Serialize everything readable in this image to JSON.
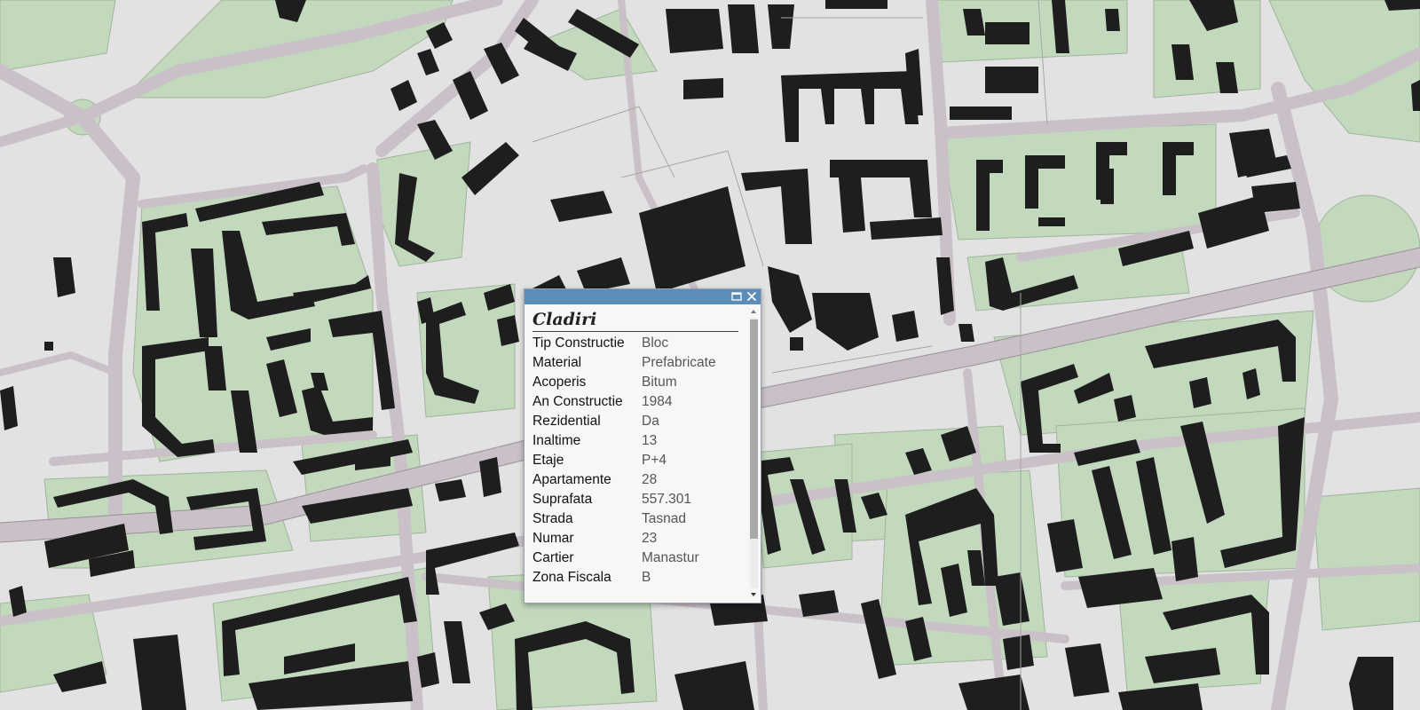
{
  "popup": {
    "title": "Cladiri",
    "maximize_icon": "maximize-icon",
    "close_icon": "close-icon",
    "fields": [
      {
        "key": "Tip Constructie",
        "value": "Bloc"
      },
      {
        "key": "Material",
        "value": "Prefabricate"
      },
      {
        "key": "Acoperis",
        "value": "Bitum"
      },
      {
        "key": "An Constructie",
        "value": "1984"
      },
      {
        "key": "Rezidential",
        "value": "Da"
      },
      {
        "key": "Inaltime",
        "value": "13"
      },
      {
        "key": "Etaje",
        "value": "P+4"
      },
      {
        "key": "Apartamente",
        "value": "28"
      },
      {
        "key": "Suprafata",
        "value": "557.301"
      },
      {
        "key": "Strada",
        "value": "Tasnad"
      },
      {
        "key": "Numar",
        "value": "23"
      },
      {
        "key": "Cartier",
        "value": "Manastur"
      },
      {
        "key": "Zona Fiscala",
        "value": "B"
      }
    ]
  },
  "colors": {
    "background": "#e2e2e2",
    "road": "#c9c0c8",
    "green": "#c3d9bd",
    "building": "#1e1e1e",
    "header": "#5b8db8"
  }
}
